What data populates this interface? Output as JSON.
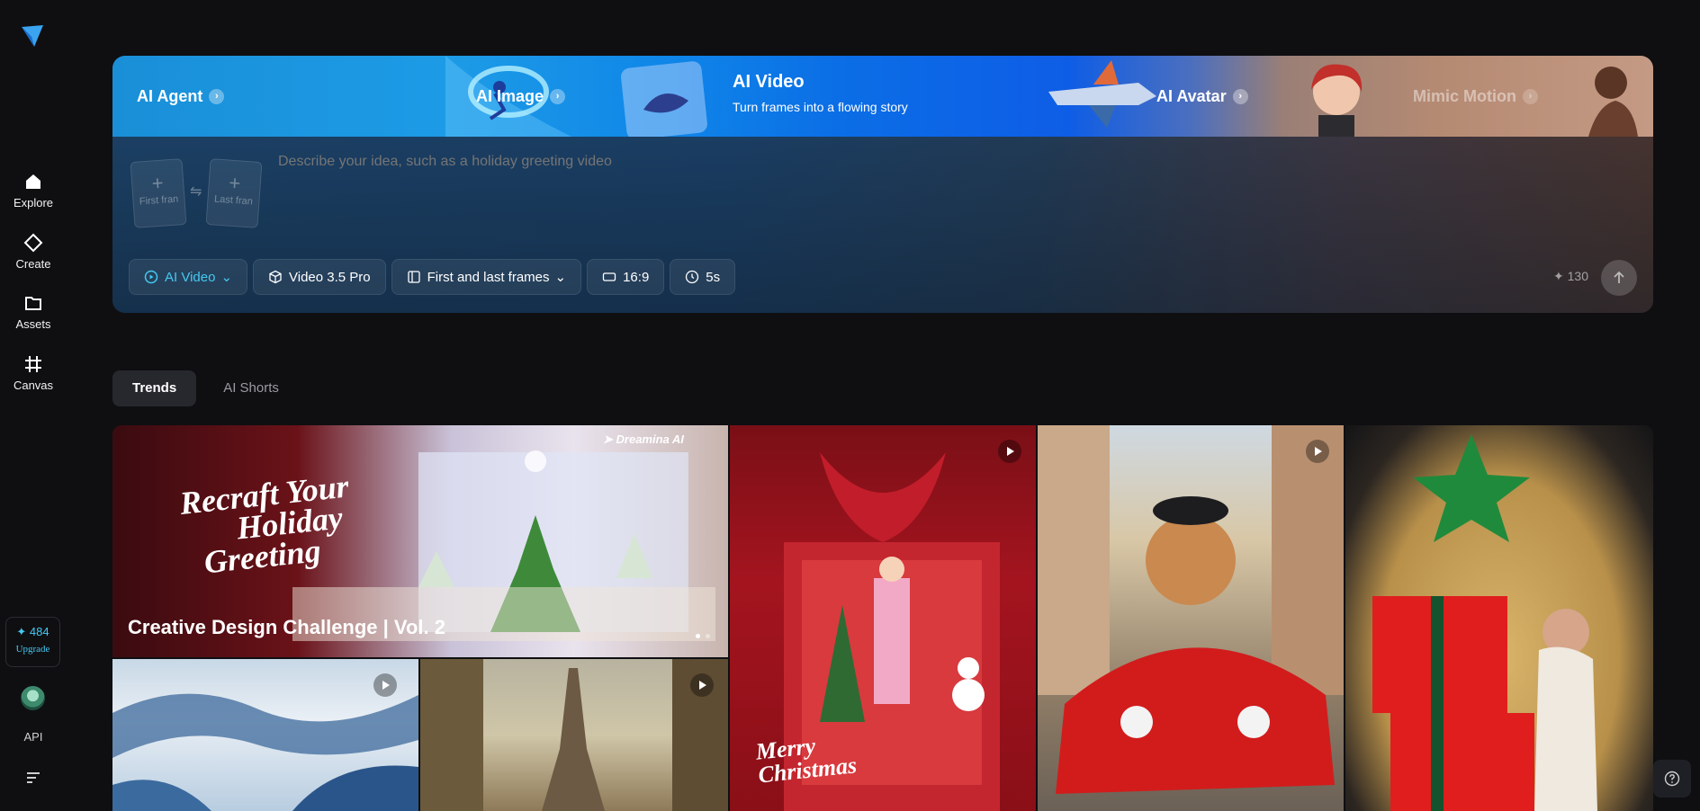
{
  "sidebar": {
    "nav": [
      {
        "label": "Explore",
        "icon": "home-icon"
      },
      {
        "label": "Create",
        "icon": "diamond-icon"
      },
      {
        "label": "Assets",
        "icon": "folder-icon"
      },
      {
        "label": "Canvas",
        "icon": "canvas-icon"
      }
    ],
    "credits": "✦ 484",
    "upgrade": "Upgrade",
    "api": "API"
  },
  "hero": {
    "tabs": [
      {
        "label": "AI Agent"
      },
      {
        "label": "AI Image"
      },
      {
        "label": "AI Avatar"
      },
      {
        "label": "Mimic Motion"
      }
    ],
    "active": {
      "title": "AI Video",
      "subtitle": "Turn frames into a flowing story"
    },
    "first_frame": "First fran",
    "last_frame": "Last fran",
    "placeholder": "Describe your idea, such as a holiday greeting video",
    "controls": {
      "mode": "AI Video",
      "model": "Video 3.5 Pro",
      "frames": "First and last frames",
      "ratio": "16:9",
      "duration": "5s"
    },
    "cost": "130"
  },
  "feed": {
    "tabs": [
      "Trends",
      "AI Shorts"
    ],
    "featured_title": "Creative Design Challenge | Vol. 2",
    "featured_headline": [
      "Recraft Your",
      "Holiday",
      "Greeting"
    ],
    "brand": "Dreamina AI",
    "card_text": [
      "Merry",
      "Christmas"
    ]
  },
  "colors": {
    "accent": "#45c9f0",
    "background": "#0f0f12"
  }
}
